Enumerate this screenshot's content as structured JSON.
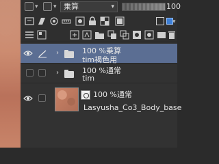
{
  "toolbar": {
    "blend_mode": "乗算",
    "blend_arrow": "▾",
    "opacity": "100",
    "opacity_level": 1.0
  },
  "layers": [
    {
      "line1": "100 %乗算",
      "line2": "tim褐色用",
      "selected": true,
      "type": "folder"
    },
    {
      "line1": "100 %通常",
      "line2": "tim",
      "selected": false,
      "type": "folder"
    },
    {
      "line1": "100 %通常",
      "line2": "Lasyusha_Co3_Body_base",
      "selected": false,
      "type": "raster"
    }
  ],
  "glyphs": {
    "chevron": "›",
    "dropdown": "▾"
  },
  "colors": {
    "selected_row": "#5b6e93",
    "panel_bg": "#323232",
    "accent_blue": "#3d7fd6"
  }
}
